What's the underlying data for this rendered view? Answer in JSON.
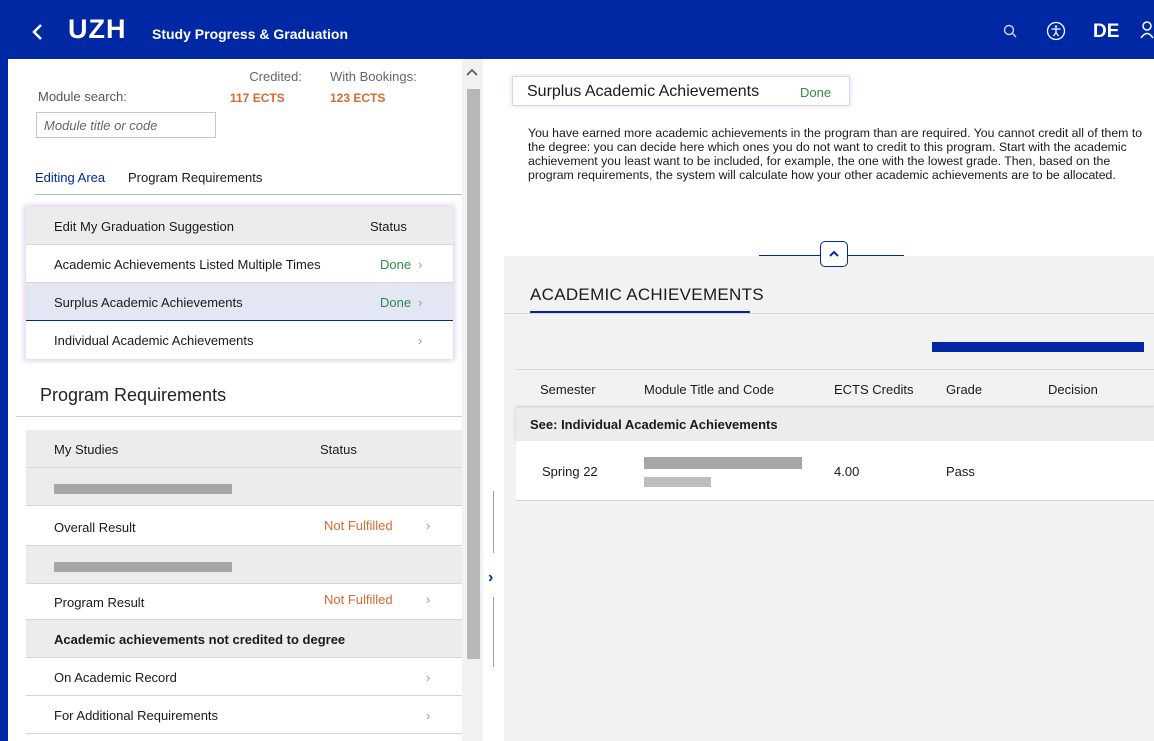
{
  "header": {
    "logo": "UZH",
    "title": "Study Progress & Graduation",
    "lang": "DE"
  },
  "left": {
    "search_label": "Module search:",
    "search_placeholder": "Module title or code",
    "credited_label": "Credited:",
    "credited_value": "117 ECTS",
    "bookings_label": "With Bookings:",
    "bookings_value": "123 ECTS",
    "tabs": [
      "Editing Area",
      "Program Requirements"
    ],
    "edit": {
      "header_name": "Edit My Graduation Suggestion",
      "header_status": "Status",
      "rows": [
        {
          "name": "Academic Achievements Listed Multiple Times",
          "status": "Done"
        },
        {
          "name": "Surplus Academic Achievements",
          "status": "Done"
        },
        {
          "name": "Individual Academic Achievements",
          "status": ""
        }
      ]
    },
    "program_title": "Program Requirements",
    "req": {
      "header_name": "My Studies",
      "header_status": "Status",
      "overall": {
        "name": "Overall Result",
        "status": "Not Fulfilled"
      },
      "program": {
        "name": "Program Result",
        "status": "Not Fulfilled"
      },
      "not_credited": "Academic achievements not credited to degree",
      "on_record": "On Academic Record",
      "additional": "For Additional Requirements"
    }
  },
  "right": {
    "surplus_title": "Surplus Academic Achievements",
    "surplus_status": "Done",
    "description": "You have earned more academic achievements in the program than are required. You cannot credit all of them to the degree: you can decide here which ones you do not want to credit to this program. Start with the academic achievement you least want to be included, for example, the one with the lowest grade. Then, based on the program requirements, the system will calculate how your other academic achievements are to be allocated.",
    "achievements_title": "ACADEMIC ACHIEVEMENTS",
    "columns": [
      "Semester",
      "Module Title and Code",
      "ECTS Credits",
      "Grade",
      "Decision"
    ],
    "group_label": "See: Individual Academic Achievements",
    "row": {
      "semester": "Spring 22",
      "ects": "4.00",
      "grade": "Pass"
    }
  },
  "colors": {
    "brand": "#0028a5",
    "done": "#2e8b4a",
    "warning": "#d9692d"
  },
  "icons": [
    "back-chevron-icon",
    "search-icon",
    "accessibility-icon",
    "user-icon",
    "chevron-right-icon",
    "chevron-up-icon"
  ]
}
